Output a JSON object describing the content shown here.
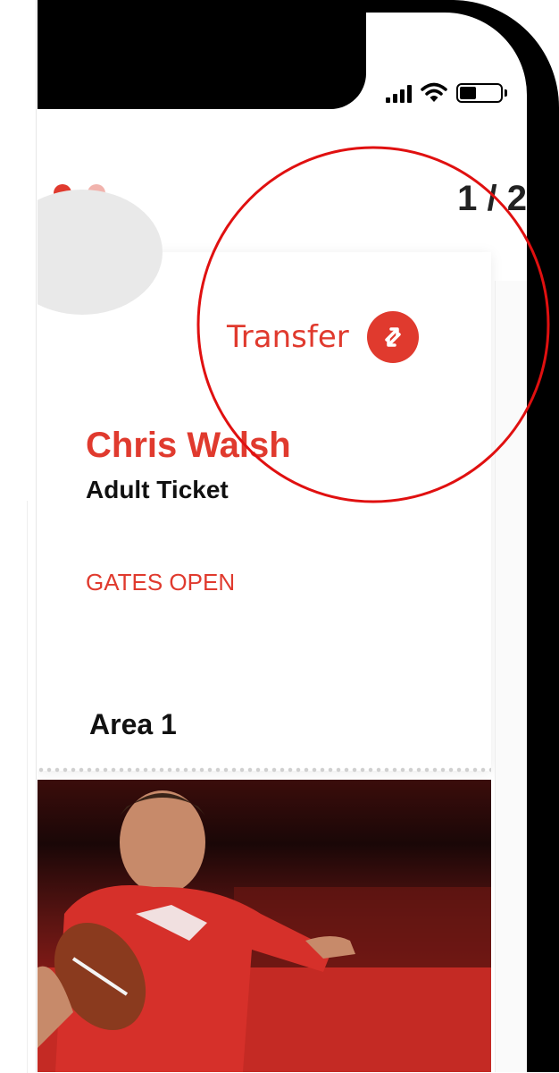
{
  "status_bar": {
    "signal_bars": 4,
    "wifi_icon": "wifi-icon",
    "battery_level": 0.4
  },
  "pager": {
    "text": "1 / 2",
    "current": 1,
    "total": 2
  },
  "ticket": {
    "transfer_label": "Transfer",
    "transfer_icon": "transfer-arrows-icon",
    "holder_name": "Chris Walsh",
    "ticket_type": "Adult Ticket",
    "gates_label": "GATES OPEN",
    "area_label": "Area 1"
  },
  "colors": {
    "accent": "#e03a2e",
    "annotation_circle": "#e01010"
  }
}
